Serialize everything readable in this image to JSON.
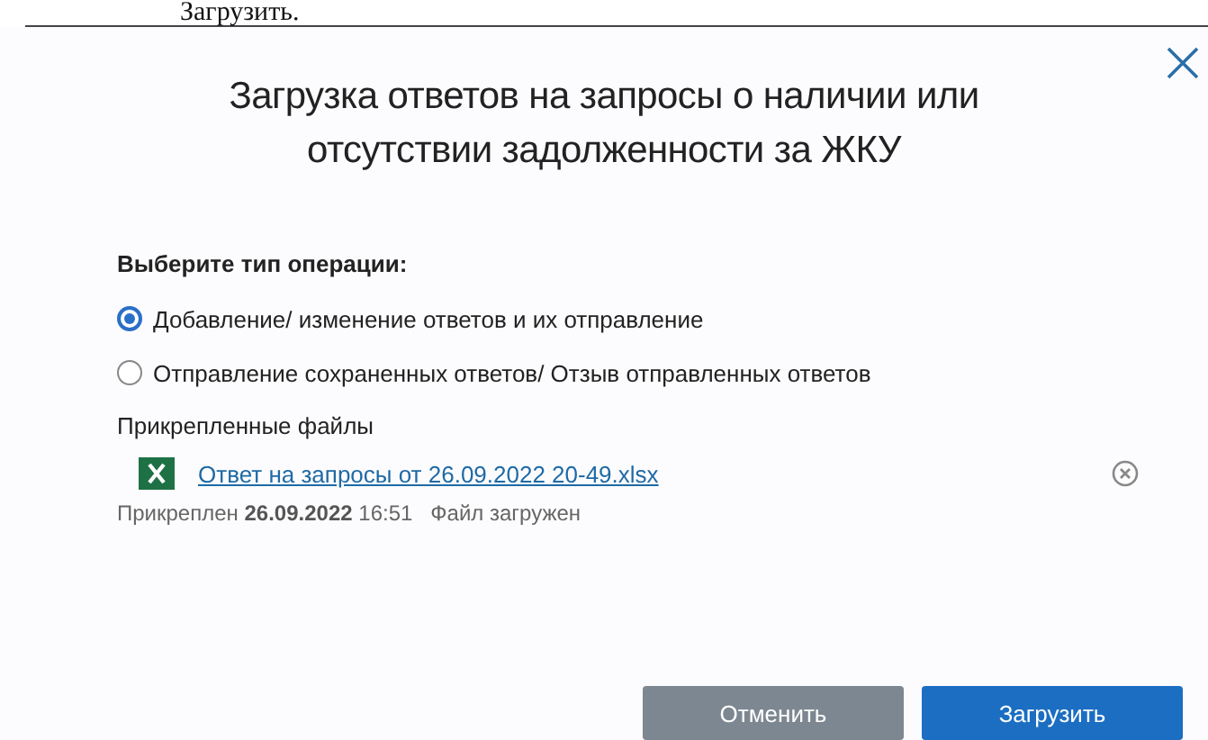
{
  "background_text": "Загрузить.",
  "dialog": {
    "title": "Загрузка ответов на запросы о наличии или отсутствии задолженности за ЖКУ",
    "operation_label": "Выберите тип операции:",
    "options": [
      {
        "label": "Добавление/ изменение ответов и их отправление",
        "selected": true
      },
      {
        "label": "Отправление сохраненных ответов/ Отзыв отправленных ответов",
        "selected": false
      }
    ],
    "attachments_label": "Прикрепленные файлы",
    "files": [
      {
        "name": "Ответ на запросы от 26.09.2022 20-49.xlsx",
        "attached_prefix": "Прикреплен",
        "date": "26.09.2022",
        "time": "16:51",
        "status": "Файл загружен"
      }
    ],
    "buttons": [
      {
        "label": "Отменить",
        "kind": "secondary"
      },
      {
        "label": "Загрузить",
        "kind": "primary"
      }
    ]
  }
}
